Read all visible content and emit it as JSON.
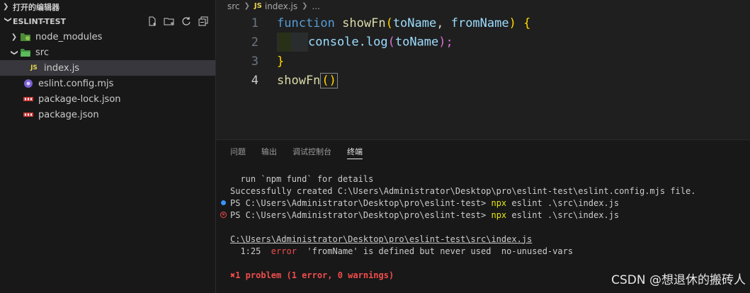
{
  "sidebar": {
    "open_editors_label": "打开的编辑器",
    "project_label": "ESLINT-TEST",
    "items": [
      {
        "label": "node_modules",
        "kind": "folder"
      },
      {
        "label": "src",
        "kind": "folder-open"
      },
      {
        "label": "index.js",
        "kind": "js"
      },
      {
        "label": "eslint.config.mjs",
        "kind": "mjs"
      },
      {
        "label": "package-lock.json",
        "kind": "json"
      },
      {
        "label": "package.json",
        "kind": "json"
      }
    ]
  },
  "breadcrumb": {
    "folder": "src",
    "js_badge": "JS",
    "file": "index.js",
    "more": "..."
  },
  "code": {
    "line_numbers": [
      "1",
      "2",
      "3",
      "4"
    ],
    "l1": {
      "kw": "function",
      "name": "showFn",
      "open": "(",
      "p1": "toName",
      "comma": ", ",
      "p2": "fromName",
      "close": ")",
      "brace": "{"
    },
    "l2": {
      "obj": "console.log",
      "open": "(",
      "arg": "toName",
      "close": ");"
    },
    "l3": {
      "brace": "}"
    },
    "l4": {
      "name": "showFn",
      "open": "(",
      "close": ")"
    }
  },
  "panel": {
    "tabs": [
      "问题",
      "输出",
      "调试控制台",
      "终端"
    ],
    "active_tab": "终端",
    "terminal": {
      "line1": "  run `npm fund` for details",
      "line2": "Successfully created C:\\Users\\Administrator\\Desktop\\pro\\eslint-test\\eslint.config.mjs file.",
      "prompt": "PS C:\\Users\\Administrator\\Desktop\\pro\\eslint-test> ",
      "cmd_npx": "npx",
      "cmd_rest": " eslint .\\src\\index.js",
      "file_path": "C:\\Users\\Administrator\\Desktop\\pro\\eslint-test\\src\\index.js",
      "err_pos": "  1:25  ",
      "err_level": "error",
      "err_msg": "  'fromName' is defined but never used  no-unused-vars",
      "summary": "1 problem (1 error, 0 warnings)"
    }
  },
  "watermark": "CSDN @想退休的搬砖人",
  "colors": {
    "error": "#f14c4c",
    "accent": "#3794ff",
    "cmd": "#e5e510"
  }
}
